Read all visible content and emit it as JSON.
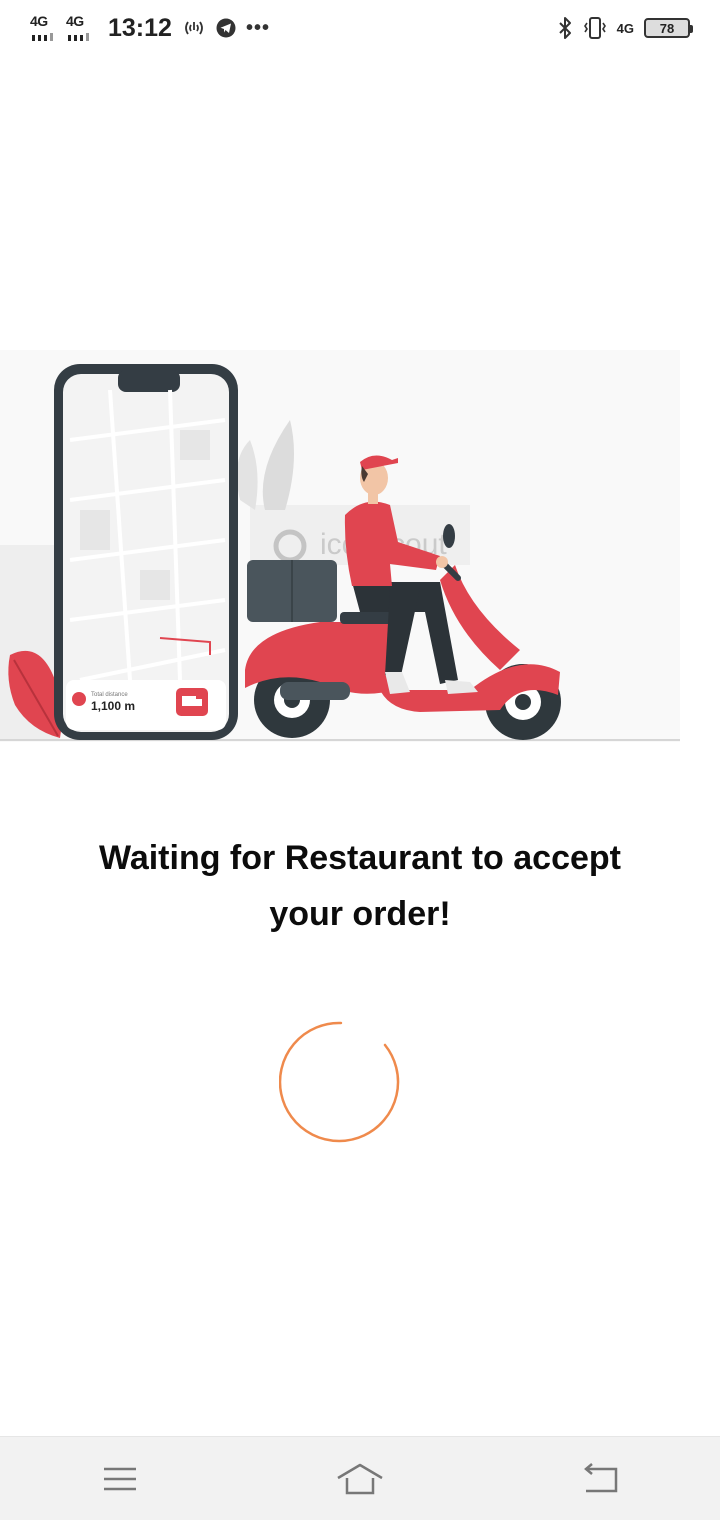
{
  "status_bar": {
    "network_1": "4G",
    "network_2": "4G",
    "time": "13:12",
    "network_3": "4G",
    "battery": "78",
    "icons": [
      "signal-bars-icon",
      "hotspot-icon",
      "telegram-icon",
      "more-icon",
      "bluetooth-icon",
      "vibrate-icon",
      "battery-icon"
    ]
  },
  "illustration": {
    "phone_card": {
      "distance_label": "Total distance",
      "distance_value": "1,100 m"
    },
    "watermark": "iconscout",
    "colors": {
      "accent_red": "#e04550",
      "dark_slate": "#343d44"
    }
  },
  "message": {
    "line1": "Waiting for Restaurant to accept",
    "line2": "your order!"
  },
  "spinner": {
    "color": "#ef8a4c"
  },
  "nav_bar": {
    "icons": [
      "menu-icon",
      "home-icon",
      "back-icon"
    ]
  }
}
